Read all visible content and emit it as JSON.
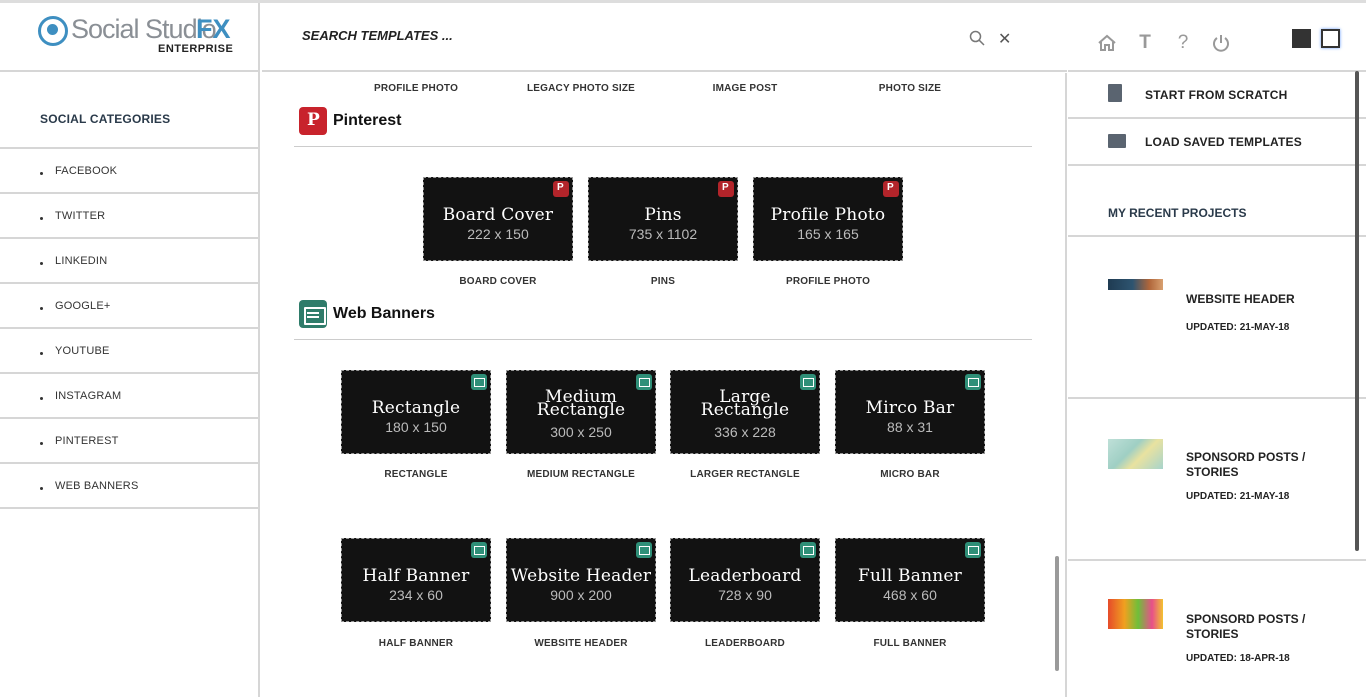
{
  "app": {
    "logo_text": "Social Studio",
    "logo_fx": "FX",
    "logo_sub": "ENTERPRISE"
  },
  "search": {
    "placeholder": "SEARCH TEMPLATES ..."
  },
  "sidebar": {
    "title": "SOCIAL CATEGORIES",
    "items": [
      {
        "label": "FACEBOOK"
      },
      {
        "label": "TWITTER"
      },
      {
        "label": "LINKEDIN"
      },
      {
        "label": "GOOGLE+"
      },
      {
        "label": "YOUTUBE"
      },
      {
        "label": "INSTAGRAM"
      },
      {
        "label": "PINTEREST"
      },
      {
        "label": "WEB BANNERS"
      }
    ]
  },
  "top_row_labels": [
    "PROFILE PHOTO",
    "LEGACY PHOTO SIZE",
    "IMAGE POST",
    "PHOTO SIZE"
  ],
  "pinterest": {
    "title": "Pinterest",
    "cards": [
      {
        "title": "Board Cover",
        "size": "222 x 150",
        "label": "BOARD COVER"
      },
      {
        "title": "Pins",
        "size": "735 x 1102",
        "label": "PINS"
      },
      {
        "title": "Profile Photo",
        "size": "165 x 165",
        "label": "PROFILE PHOTO"
      }
    ]
  },
  "web_banners": {
    "title": "Web Banners",
    "cards": [
      {
        "title": "Rectangle",
        "size": "180 x 150",
        "label": "RECTANGLE"
      },
      {
        "title": "Medium",
        "title2": "Rectangle",
        "size": "300 x 250",
        "label": "MEDIUM RECTANGLE"
      },
      {
        "title": "Large",
        "title2": "Rectangle",
        "size": "336 x 228",
        "label": "LARGER RECTANGLE"
      },
      {
        "title": "Mirco Bar",
        "size": "88 x 31",
        "label": "MICRO BAR"
      },
      {
        "title": "Half Banner",
        "size": "234 x 60",
        "label": "HALF BANNER"
      },
      {
        "title": "Website Header",
        "size": "900 x 200",
        "label": "WEBSITE HEADER"
      },
      {
        "title": "Leaderboard",
        "size": "728 x 90",
        "label": "LEADERBOARD"
      },
      {
        "title": "Full Banner",
        "size": "468 x 60",
        "label": "FULL BANNER"
      }
    ]
  },
  "actions": {
    "start": "START FROM SCRATCH",
    "load": "LOAD SAVED TEMPLATES"
  },
  "recent": {
    "title": "MY RECENT PROJECTS",
    "projects": [
      {
        "title": "WEBSITE HEADER",
        "updated": "UPDATED: 21-MAY-18"
      },
      {
        "title": "SPONSORD POSTS / STORIES",
        "updated": "UPDATED: 21-MAY-18"
      },
      {
        "title": "SPONSORD POSTS / STORIES",
        "updated": "UPDATED: 18-APR-18"
      }
    ]
  },
  "colors": {
    "accent": "#3e8fc1",
    "pinterest": "#c8232c",
    "web_banner": "#2f7c6a",
    "card_bg": "#121212"
  }
}
